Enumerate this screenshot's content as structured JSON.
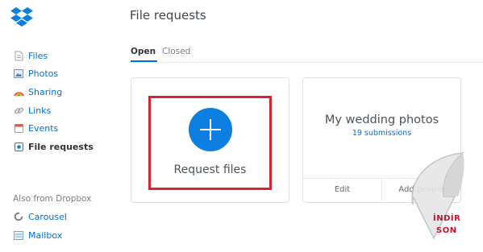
{
  "app": {
    "logo_icon": "dropbox-logo",
    "brand_color": "#0070e0"
  },
  "page": {
    "title": "File requests"
  },
  "sidebar": {
    "items": [
      {
        "label": "Files",
        "icon": "file-icon"
      },
      {
        "label": "Photos",
        "icon": "photos-icon"
      },
      {
        "label": "Sharing",
        "icon": "sharing-icon"
      },
      {
        "label": "Links",
        "icon": "link-icon"
      },
      {
        "label": "Events",
        "icon": "calendar-icon"
      },
      {
        "label": "File requests",
        "icon": "file-request-icon",
        "active": true
      }
    ],
    "also_label": "Also from Dropbox",
    "also_items": [
      {
        "label": "Carousel",
        "icon": "carousel-icon"
      },
      {
        "label": "Mailbox",
        "icon": "mailbox-icon"
      }
    ]
  },
  "tabs": [
    {
      "label": "Open",
      "active": true
    },
    {
      "label": "Closed",
      "active": false
    }
  ],
  "cards": {
    "request": {
      "label": "Request files",
      "icon": "plus-icon",
      "highlight_color": "#d62530"
    },
    "existing": {
      "title": "My wedding photos",
      "subtitle": "19 submissions",
      "edit_label": "Edit",
      "add_label": "Add people"
    }
  },
  "watermark": {
    "line1": "İNDİR",
    "line2": "SON"
  }
}
